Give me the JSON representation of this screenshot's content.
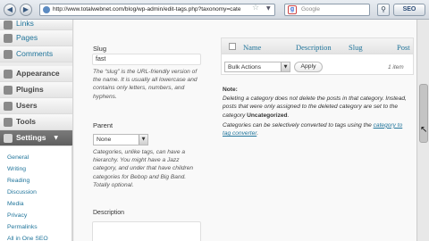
{
  "browser": {
    "url": "http://www.totalwebnet.com/blog/wp-admin/edit-tags.php?taxonomy=cate",
    "search_placeholder": "Google",
    "seo_label": "SEO",
    "back_glyph": "◀",
    "forward_glyph": "▶",
    "star_glyph": "☆",
    "drop_glyph": "▼",
    "search_go_glyph": "⚲"
  },
  "sidebar": {
    "items": [
      {
        "label": "Links",
        "icon": "links-icon"
      },
      {
        "label": "Pages",
        "icon": "pages-icon"
      },
      {
        "label": "Comments",
        "icon": "comments-icon"
      },
      {
        "label": "Appearance",
        "icon": "appearance-icon"
      },
      {
        "label": "Plugins",
        "icon": "plugins-icon"
      },
      {
        "label": "Users",
        "icon": "users-icon"
      },
      {
        "label": "Tools",
        "icon": "tools-icon"
      },
      {
        "label": "Settings",
        "icon": "settings-icon"
      }
    ],
    "settings_arrow": "▼",
    "submenu": [
      "General",
      "Writing",
      "Reading",
      "Discussion",
      "Media",
      "Privacy",
      "Permalinks",
      "All in One SEO"
    ]
  },
  "form": {
    "slug_label": "Slug",
    "slug_value": "fast",
    "slug_desc": "The “slug” is the URL-friendly version of the name. It is usually all lowercase and contains only letters, numbers, and hyphens.",
    "parent_label": "Parent",
    "parent_value": "None",
    "parent_desc": "Categories, unlike tags, can have a hierarchy. You might have a Jazz category, and under that have children categories for Bebop and Big Band. Totally optional.",
    "description_label": "Description"
  },
  "table": {
    "columns": [
      "Name",
      "Description",
      "Slug",
      "Post"
    ],
    "bulk_actions": "Bulk Actions",
    "apply_label": "Apply",
    "item_count": "1 item"
  },
  "note": {
    "heading": "Note:",
    "line1": "Deleting a category does not delete the posts in that category. Instead, posts that were only assigned to the deleted category are set to the category ",
    "uncategorized": "Uncategorized",
    "line1_end": ".",
    "line2": "Categories can be selectively converted to tags using the ",
    "converter_link": "category to tag converter",
    "line2_end": "."
  },
  "colors": {
    "link": "#21759b",
    "menu_active": "#6b6b6b"
  }
}
